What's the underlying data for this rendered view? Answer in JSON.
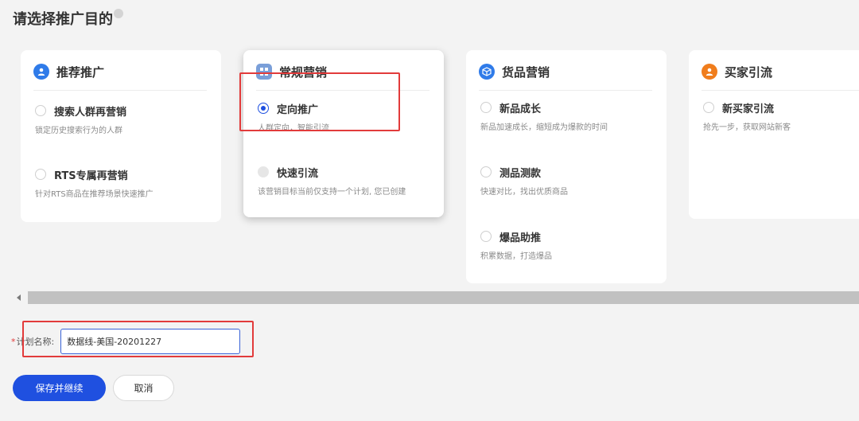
{
  "header": {
    "title": "请选择推广目的"
  },
  "cards": [
    {
      "title": "推荐推广",
      "icon": "user-icon",
      "options": [
        {
          "label": "搜索人群再营销",
          "desc": "锁定历史搜索行为的人群"
        },
        {
          "label": "RTS专属再营销",
          "desc": "针对RTS商品在推荐场景快速推广"
        }
      ]
    },
    {
      "title": "常规营销",
      "icon": "grid-icon",
      "options": [
        {
          "label": "定向推广",
          "desc": "人群定向，智能引流"
        },
        {
          "label": "快速引流",
          "desc": "该营销目标当前仅支持一个计划, 您已创建"
        }
      ]
    },
    {
      "title": "货品营销",
      "icon": "cube-icon",
      "options": [
        {
          "label": "新品成长",
          "desc": "新品加速成长，缩短成为爆款的时间"
        },
        {
          "label": "测品测款",
          "desc": "快速对比，找出优质商品"
        },
        {
          "label": "爆品助推",
          "desc": "积累数据，打造爆品"
        }
      ]
    },
    {
      "title": "买家引流",
      "icon": "buyer-icon",
      "options": [
        {
          "label": "新买家引流",
          "desc": "抢先一步，获取网站新客"
        }
      ]
    }
  ],
  "selected_option": "定向推广",
  "form": {
    "required_mark": "*",
    "plan_name_label": "计划名称:",
    "plan_name_value": "数据线-美国-20201227"
  },
  "buttons": {
    "save": "保存并继续",
    "cancel": "取消"
  },
  "colors": {
    "accent": "#1f50e0",
    "highlight_box": "#e23b3b",
    "icon_blue": "#2f7be9",
    "icon_orange": "#f07d1c"
  }
}
